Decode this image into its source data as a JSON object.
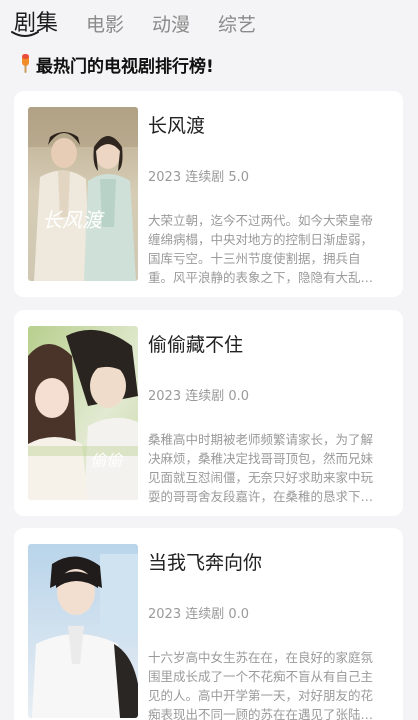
{
  "tabs": [
    {
      "label": "剧集",
      "active": true
    },
    {
      "label": "电影",
      "active": false
    },
    {
      "label": "动漫",
      "active": false
    },
    {
      "label": "综艺",
      "active": false
    }
  ],
  "heading": {
    "icon": "popsicle-icon",
    "text": "最热门的电视剧排行榜!"
  },
  "items": [
    {
      "title": "长风渡",
      "meta": "2023 连续剧 5.0",
      "poster_text": "长风渡",
      "desc": "大荣立朝，迄今不过两代。如今大荣皇帝缠绵病榻，中央对地方的控制日渐虚弱，国库亏空。十三州节度使割据，拥兵自重。风平浪静的表象之下，隐隐有大乱将至的迹象。"
    },
    {
      "title": "偷偷藏不住",
      "meta": "2023 连续剧 0.0",
      "poster_text": "偷偷",
      "desc": "桑稚高中时期被老师频繁请家长，为了解决麻烦，桑稚决定找哥哥顶包，然而兄妹见面就互怼闹僵，无奈只好求助来家中玩耍的哥哥舍友段嘉许，在桑稚的恳求下段嘉许答应了。"
    },
    {
      "title": "当我飞奔向你",
      "meta": "2023 连续剧 0.0",
      "poster_text": "",
      "desc": "十六岁高中女生苏在在，在良好的家庭氛围里成长成了一个不花痴不盲从有自己主见的人。高中开学第一天，对好朋友的花痴表现出不同一顾的苏在在遇见了张陆让。"
    }
  ]
}
